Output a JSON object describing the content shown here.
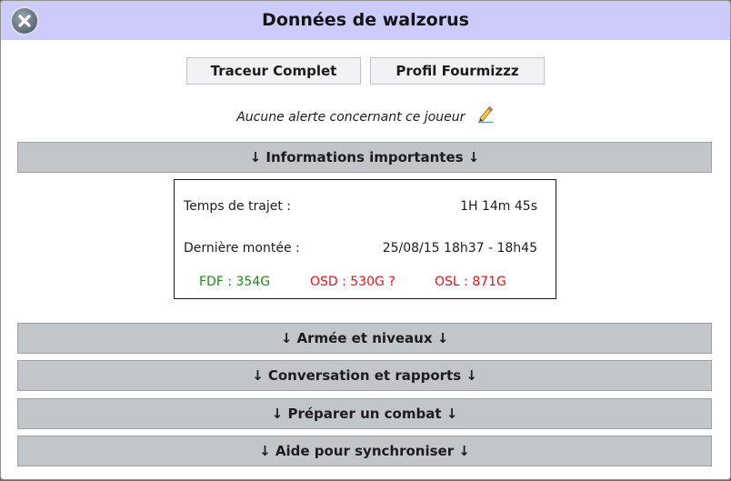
{
  "dialog": {
    "title": "Données de walzorus",
    "close_icon": "close-circle-icon"
  },
  "buttons": {
    "tracer": "Traceur Complet",
    "profile": "Profil Fourmizzz"
  },
  "alert": {
    "text": "Aucune alerte concernant ce joueur",
    "edit_icon": "pencil-icon"
  },
  "sections": {
    "important": "↓ Informations importantes ↓",
    "army": "↓ Armée et niveaux ↓",
    "conversation": "↓ Conversation et rapports ↓",
    "combat": "↓ Préparer un combat ↓",
    "sync": "↓ Aide pour synchroniser ↓"
  },
  "info": {
    "travel_label": "Temps de trajet :",
    "travel_value": "1H 14m 45s",
    "last_label": "Dernière montée :",
    "last_value": "25/08/15 18h37 - 18h45",
    "fdf": "FDF : 354G",
    "osd": "OSD : 530G ?",
    "osl": "OSL : 871G"
  },
  "colors": {
    "titlebar": "#cccbfb",
    "section_bar": "#c3c6c9",
    "fdf": "#1e8a1e",
    "osd": "#e0141e",
    "osl": "#e0141e"
  }
}
